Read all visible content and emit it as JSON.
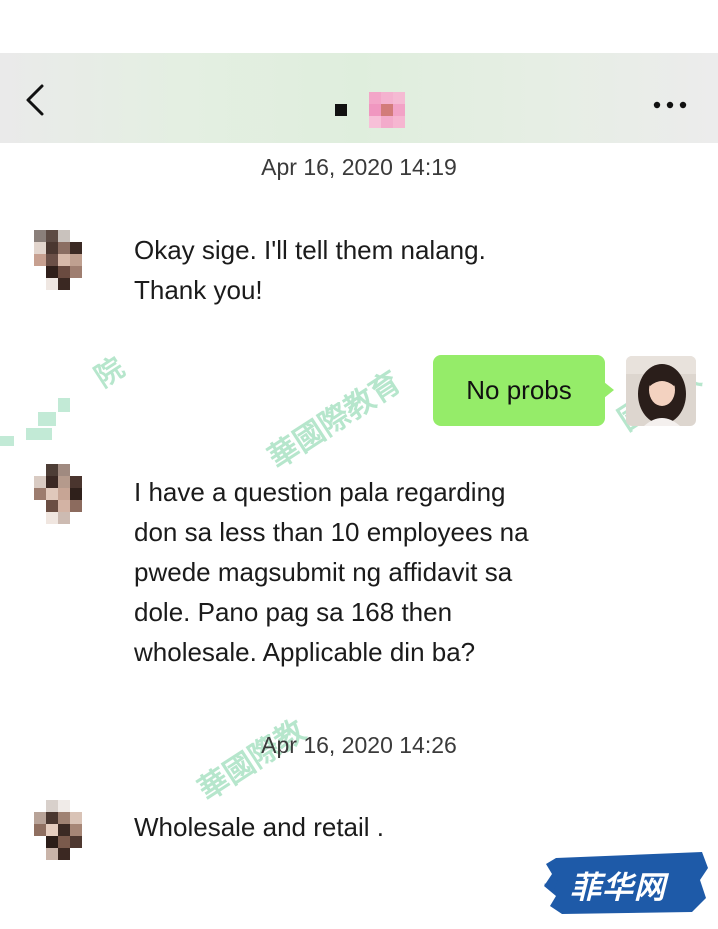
{
  "header": {
    "back_icon": "chevron-left-icon",
    "more_icon": "more-dots-icon",
    "background_accent": "#e4efe2"
  },
  "messages": [
    {
      "type": "timestamp",
      "text": "Apr 16, 2020 14:19"
    },
    {
      "type": "incoming",
      "lines": [
        "Okay sige. I'll tell them nalang.",
        "Thank you!"
      ]
    },
    {
      "type": "outgoing",
      "text": "No probs",
      "bubble_color": "#95ec69"
    },
    {
      "type": "incoming",
      "lines": [
        "I have a question pala regarding",
        "don sa less than 10 employees na",
        "pwede  magsubmit ng affidavit sa",
        "dole. Pano pag sa 168 then",
        "wholesale. Applicable din ba?"
      ]
    },
    {
      "type": "timestamp",
      "text": "Apr 16, 2020 14:26"
    },
    {
      "type": "incoming",
      "lines": [
        "Wholesale and retail ."
      ]
    }
  ],
  "watermarks": {
    "phrase_1": "華國際教育",
    "phrase_2": "華國際教",
    "phrase_3": "國際教",
    "phrase_4": "院",
    "color": "#7cd2a3"
  },
  "logo": {
    "text": "菲华网",
    "color": "#1e5aa8"
  }
}
